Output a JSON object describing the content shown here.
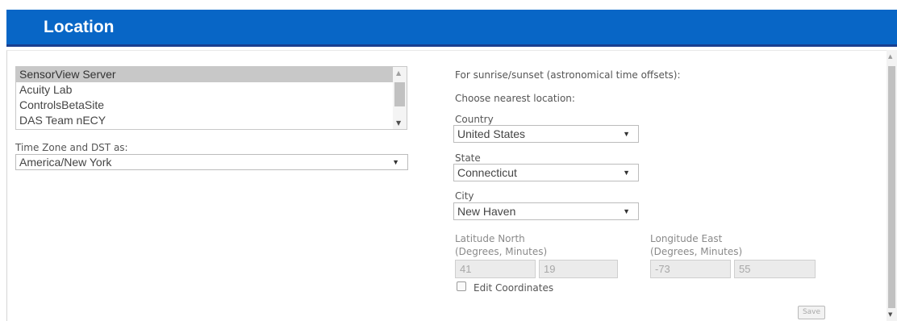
{
  "header": {
    "title": "Location"
  },
  "servers": {
    "items": [
      "SensorView Server",
      "Acuity Lab",
      "ControlsBetaSite",
      "DAS Team nECY"
    ],
    "selected": "SensorView Server"
  },
  "timezone": {
    "label": "Time Zone and DST as:",
    "value": "America/New York"
  },
  "sun": {
    "intro": "For sunrise/sunset (astronomical time offsets):",
    "choose": "Choose nearest location:"
  },
  "country": {
    "label": "Country",
    "value": "United States"
  },
  "state": {
    "label": "State",
    "value": "Connecticut"
  },
  "city": {
    "label": "City",
    "value": "New Haven"
  },
  "latitude": {
    "label1": "Latitude North",
    "label2": "(Degrees, Minutes)",
    "degrees": "41",
    "minutes": "19"
  },
  "longitude": {
    "label1": "Longitude East",
    "label2": "(Degrees, Minutes)",
    "degrees": "-73",
    "minutes": "55"
  },
  "edit_coordinates": {
    "label": "Edit Coordinates",
    "checked": false
  },
  "save": {
    "label": "Save"
  },
  "colors": {
    "header": "#0866c6",
    "header_border": "#1b3f8f",
    "selected_row": "#c8c8c8"
  }
}
